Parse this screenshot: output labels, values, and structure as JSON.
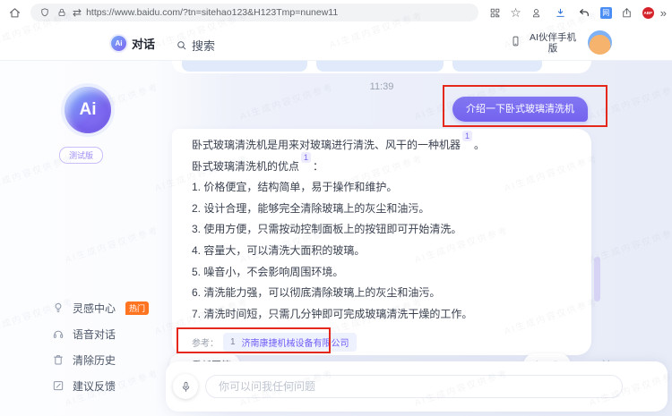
{
  "watermark": "AI生成内容仅供参考",
  "browser": {
    "url": "https://www.baidu.com/?tn=sitehao123&H123Tmp=nunew11"
  },
  "icons": {
    "swap_glyph": "⇄",
    "star_glyph": "☆",
    "more_glyph": "»",
    "refresh_glyph": "↻",
    "net_glyph": "网",
    "abp_glyph": "ABP"
  },
  "header": {
    "ai_logo_text": "Ai",
    "chat_tab": "对话",
    "search_tab": "搜索",
    "mobile_label": "AI伙伴手机版"
  },
  "sidebar": {
    "logo_text": "Ai",
    "beta_badge": "测试版",
    "items": [
      {
        "label": "灵感中心",
        "badge": "热门"
      },
      {
        "label": "语音对话",
        "badge": ""
      },
      {
        "label": "清除历史",
        "badge": ""
      },
      {
        "label": "建议反馈",
        "badge": ""
      }
    ]
  },
  "chat": {
    "timestamp": "11:39",
    "user_message": "介绍一下卧式玻璃清洗机",
    "answer_p1": "卧式玻璃清洗机是用来对玻璃进行清洗、风干的一种机器",
    "answer_p1_ref": "1",
    "answer_p1_end": "。",
    "answer_p2": "卧式玻璃清洗机的优点",
    "answer_p2_ref": "1",
    "answer_p2_end": "：",
    "points": [
      "1. 价格便宜，结构简单，易于操作和维护。",
      "2. 设计合理，能够完全清除玻璃上的灰尘和油污。",
      "3. 使用方便，只需按动控制面板上的按钮即可开始清洗。",
      "4. 容量大，可以清洗大面积的玻璃。",
      "5. 噪音小，不会影响周围环境。",
      "6. 清洗能力强，可以彻底清除玻璃上的灰尘和油污。",
      "7. 清洗时间短，只需几分钟即可完成玻璃清洗干燥的工作。"
    ],
    "reference_label": "参考：",
    "reference_index": "1",
    "reference_link": "济南康捷机械设备有限公司",
    "regenerate_label": "重新回答",
    "input_placeholder": "你可以问我任何问题"
  },
  "colors": {
    "accent_purple": "#7a6cf1",
    "annotation_red": "#e5281c",
    "hot_badge_orange": "#ff7420",
    "link_purple": "#6e5ef5"
  }
}
